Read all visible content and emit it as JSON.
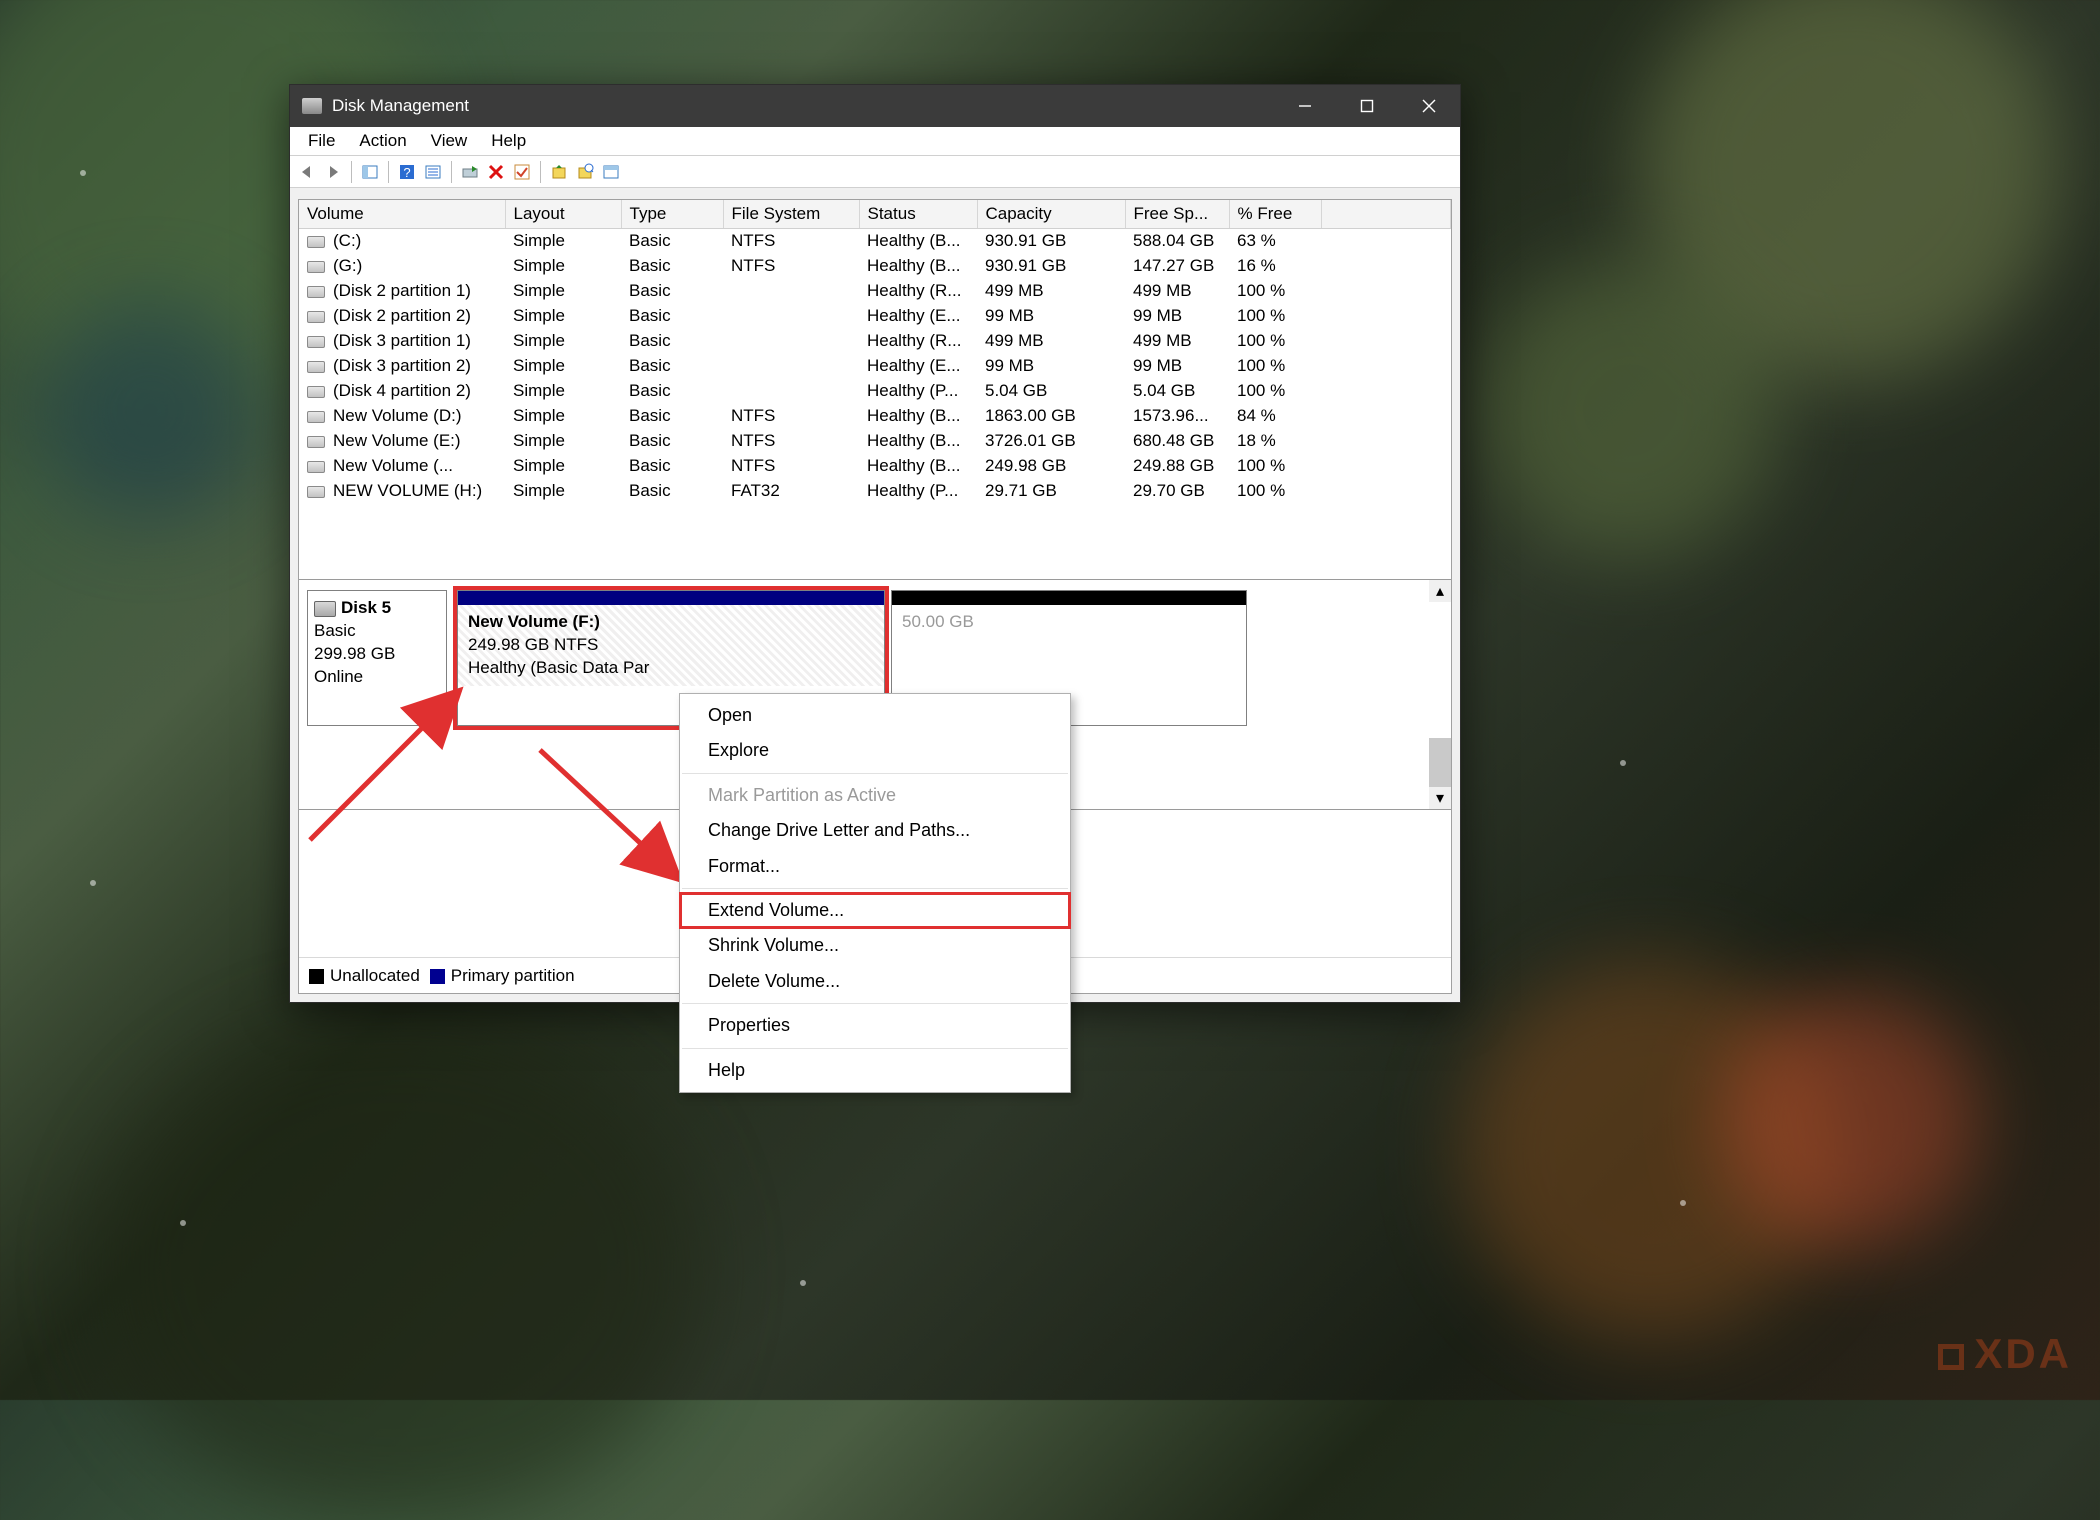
{
  "window": {
    "title": "Disk Management"
  },
  "menu": {
    "file": "File",
    "action": "Action",
    "view": "View",
    "help": "Help"
  },
  "columns": {
    "volume": "Volume",
    "layout": "Layout",
    "type": "Type",
    "fs": "File System",
    "status": "Status",
    "capacity": "Capacity",
    "free": "Free Sp...",
    "pct": "% Free"
  },
  "volumes": [
    {
      "name": "(C:)",
      "layout": "Simple",
      "type": "Basic",
      "fs": "NTFS",
      "status": "Healthy (B...",
      "capacity": "930.91 GB",
      "free": "588.04 GB",
      "pct": "63 %"
    },
    {
      "name": "(G:)",
      "layout": "Simple",
      "type": "Basic",
      "fs": "NTFS",
      "status": "Healthy (B...",
      "capacity": "930.91 GB",
      "free": "147.27 GB",
      "pct": "16 %"
    },
    {
      "name": "(Disk 2 partition 1)",
      "layout": "Simple",
      "type": "Basic",
      "fs": "",
      "status": "Healthy (R...",
      "capacity": "499 MB",
      "free": "499 MB",
      "pct": "100 %"
    },
    {
      "name": "(Disk 2 partition 2)",
      "layout": "Simple",
      "type": "Basic",
      "fs": "",
      "status": "Healthy (E...",
      "capacity": "99 MB",
      "free": "99 MB",
      "pct": "100 %"
    },
    {
      "name": "(Disk 3 partition 1)",
      "layout": "Simple",
      "type": "Basic",
      "fs": "",
      "status": "Healthy (R...",
      "capacity": "499 MB",
      "free": "499 MB",
      "pct": "100 %"
    },
    {
      "name": "(Disk 3 partition 2)",
      "layout": "Simple",
      "type": "Basic",
      "fs": "",
      "status": "Healthy (E...",
      "capacity": "99 MB",
      "free": "99 MB",
      "pct": "100 %"
    },
    {
      "name": "(Disk 4 partition 2)",
      "layout": "Simple",
      "type": "Basic",
      "fs": "",
      "status": "Healthy (P...",
      "capacity": "5.04 GB",
      "free": "5.04 GB",
      "pct": "100 %"
    },
    {
      "name": "New Volume (D:)",
      "layout": "Simple",
      "type": "Basic",
      "fs": "NTFS",
      "status": "Healthy (B...",
      "capacity": "1863.00 GB",
      "free": "1573.96...",
      "pct": "84 %"
    },
    {
      "name": "New Volume (E:)",
      "layout": "Simple",
      "type": "Basic",
      "fs": "NTFS",
      "status": "Healthy (B...",
      "capacity": "3726.01 GB",
      "free": "680.48 GB",
      "pct": "18 %"
    },
    {
      "name": "New Volume (...",
      "layout": "Simple",
      "type": "Basic",
      "fs": "NTFS",
      "status": "Healthy (B...",
      "capacity": "249.98 GB",
      "free": "249.88 GB",
      "pct": "100 %"
    },
    {
      "name": "NEW VOLUME (H:)",
      "layout": "Simple",
      "type": "Basic",
      "fs": "FAT32",
      "status": "Healthy (P...",
      "capacity": "29.71 GB",
      "free": "29.70 GB",
      "pct": "100 %"
    }
  ],
  "disk": {
    "label": "Disk 5",
    "type": "Basic",
    "size": "299.98 GB",
    "status": "Online",
    "partition1": {
      "title": "New Volume  (F:)",
      "line2": "249.98 GB NTFS",
      "line3": "Healthy (Basic Data Par"
    },
    "partition2": {
      "title_truncated": "50.00 GB"
    }
  },
  "legend": {
    "unalloc": "Unallocated",
    "primary": "Primary partition"
  },
  "context": {
    "open": "Open",
    "explore": "Explore",
    "mark_active": "Mark Partition as Active",
    "change_letter": "Change Drive Letter and Paths...",
    "format": "Format...",
    "extend": "Extend Volume...",
    "shrink": "Shrink Volume...",
    "delete": "Delete Volume...",
    "properties": "Properties",
    "help": "Help"
  },
  "watermark": "XDA"
}
